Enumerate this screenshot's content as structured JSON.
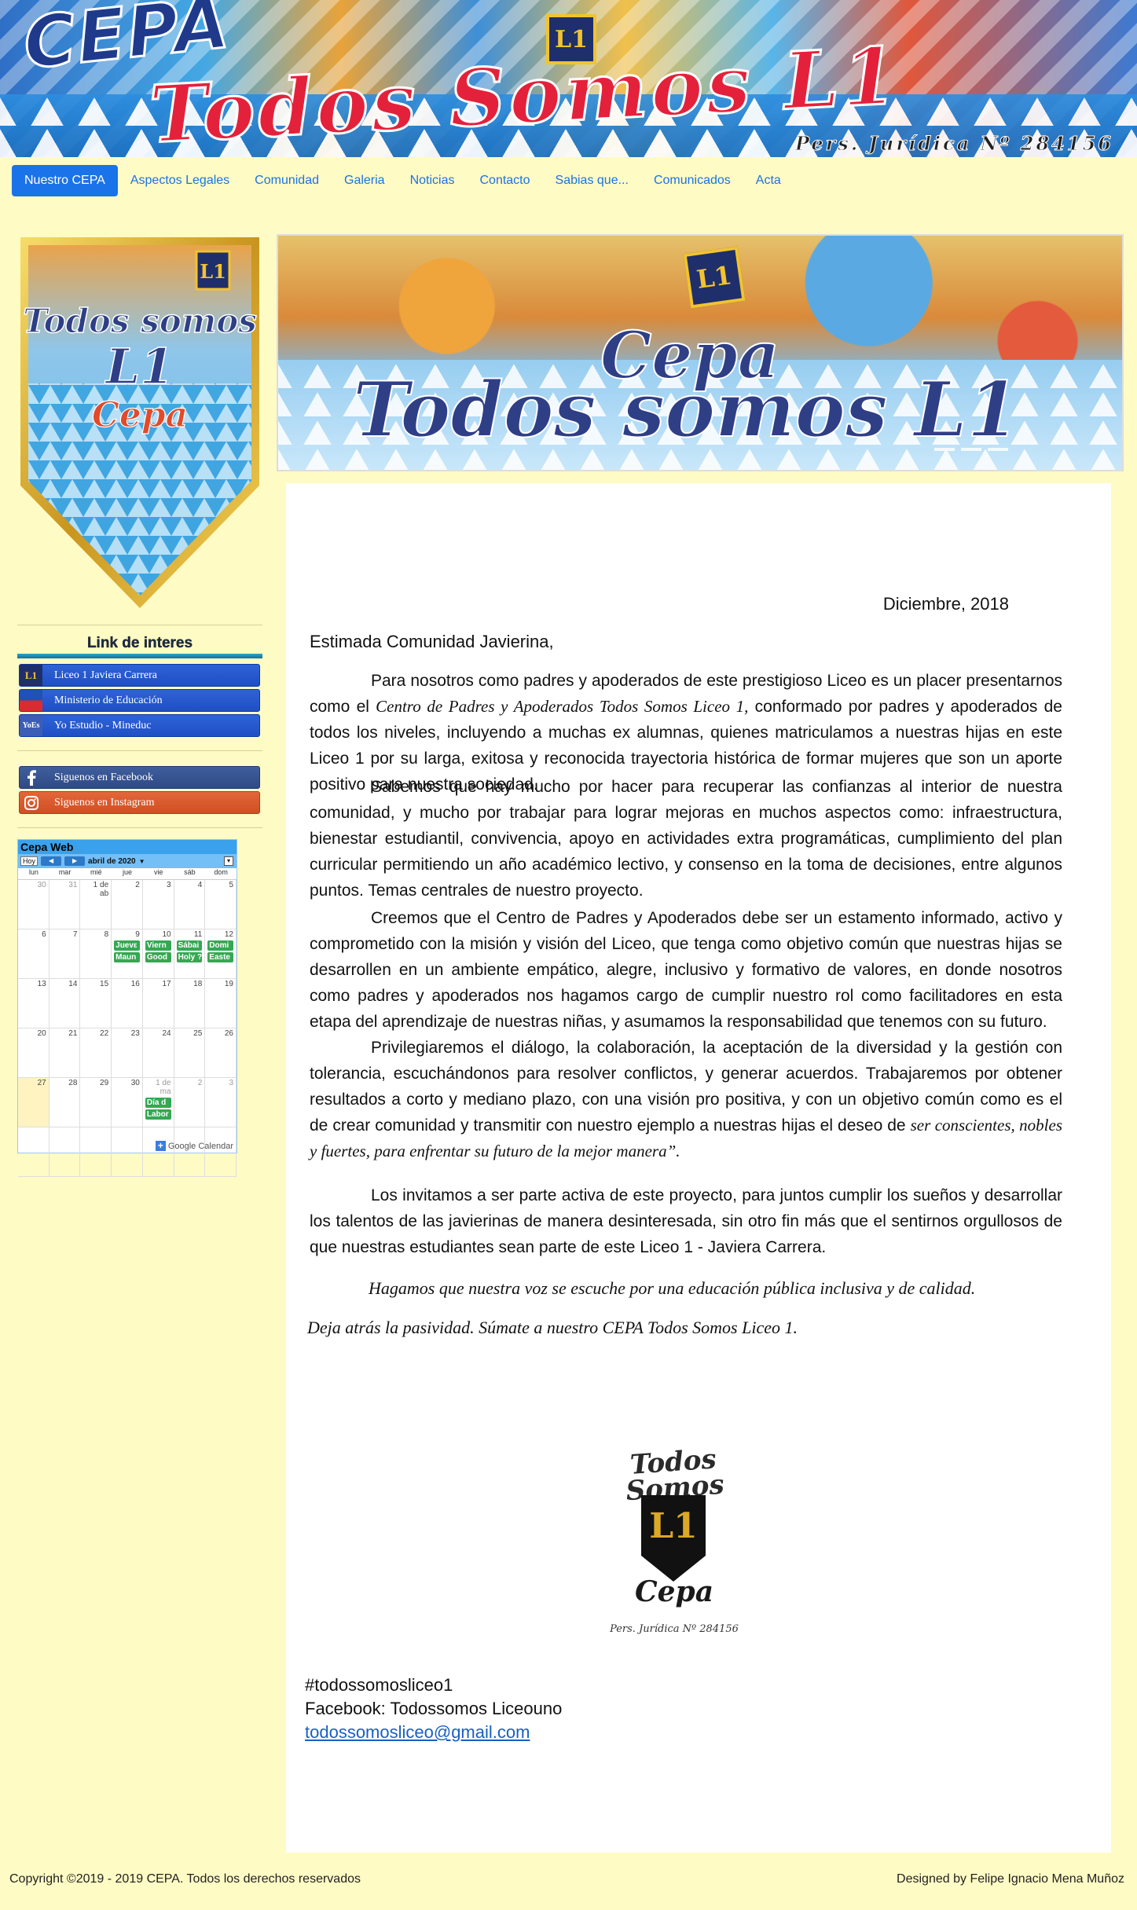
{
  "header": {
    "brand": "CEPA",
    "slogan": "Todos Somos L1",
    "badge": "L1",
    "legal": "Pers. Jurídica  Nº 284156"
  },
  "nav": {
    "items": [
      "Nuestro CEPA",
      "Aspectos Legales",
      "Comunidad",
      "Galeria",
      "Noticias",
      "Contacto",
      "Sabias que...",
      "Comunicados",
      "Acta"
    ],
    "active": "Nuestro CEPA"
  },
  "sidebar": {
    "pennant": {
      "line1": "Todos somos",
      "line2": "L1",
      "line3": "Cepa",
      "badge": "L1"
    },
    "links_title": "Link de interes",
    "links": [
      {
        "label": "Liceo 1 Javiera Carrera",
        "icon": "L1"
      },
      {
        "label": "Ministerio de Educación",
        "icon": ""
      },
      {
        "label": "Yo Estudio - Mineduc",
        "icon": "YoEs"
      }
    ],
    "social": [
      {
        "label": "Siguenos en Facebook",
        "icon": "facebook-icon"
      },
      {
        "label": "Siguenos en Instagram",
        "icon": "instagram-icon"
      }
    ]
  },
  "calendar": {
    "title": "Cepa Web",
    "today_button": "Hoy",
    "month": "abril de 2020",
    "weekdays": [
      "lun",
      "mar",
      "mié",
      "jue",
      "vie",
      "sáb",
      "dom"
    ],
    "weeks": [
      [
        {
          "d": "30",
          "o": true
        },
        {
          "d": "31",
          "o": true
        },
        {
          "d": "1 de ab"
        },
        {
          "d": "2"
        },
        {
          "d": "3"
        },
        {
          "d": "4"
        },
        {
          "d": "5"
        }
      ],
      [
        {
          "d": "6"
        },
        {
          "d": "7"
        },
        {
          "d": "8"
        },
        {
          "d": "9",
          "ev": [
            "Juevε",
            "Maun"
          ]
        },
        {
          "d": "10",
          "ev": [
            "Viern",
            "Good"
          ]
        },
        {
          "d": "11",
          "ev": [
            "Sábai",
            "Holy ?"
          ]
        },
        {
          "d": "12",
          "ev": [
            "Domi",
            "Easte"
          ]
        }
      ],
      [
        {
          "d": "13"
        },
        {
          "d": "14"
        },
        {
          "d": "15"
        },
        {
          "d": "16"
        },
        {
          "d": "17"
        },
        {
          "d": "18"
        },
        {
          "d": "19"
        }
      ],
      [
        {
          "d": "20"
        },
        {
          "d": "21"
        },
        {
          "d": "22"
        },
        {
          "d": "23"
        },
        {
          "d": "24"
        },
        {
          "d": "25"
        },
        {
          "d": "26"
        }
      ],
      [
        {
          "d": "27",
          "t": true
        },
        {
          "d": "28"
        },
        {
          "d": "29"
        },
        {
          "d": "30"
        },
        {
          "d": "1 de ma",
          "o": true,
          "ev": [
            "Día d",
            "Labor"
          ]
        },
        {
          "d": "2",
          "o": true
        },
        {
          "d": "3",
          "o": true
        }
      ],
      [
        {
          "d": ""
        },
        {
          "d": ""
        },
        {
          "d": ""
        },
        {
          "d": ""
        },
        {
          "d": ""
        },
        {
          "d": ""
        },
        {
          "d": ""
        }
      ]
    ],
    "footer": "Google Calendar",
    "footer_plus": "+"
  },
  "banner": {
    "line1": "Cepa",
    "line2": "Todos somos L1",
    "badge": "L1"
  },
  "letter": {
    "date": "Diciembre, 2018",
    "greeting": "Estimada Comunidad Javierina,",
    "p1_a": "Para nosotros como padres y apoderados de este prestigioso Liceo es un placer presentarnos como el ",
    "p1_em": "Centro de Padres y Apoderados Todos Somos Liceo 1,",
    "p1_b": " conformado por padres y apoderados de todos los niveles, incluyendo a muchas ex alumnas, quienes matriculamos a nuestras hijas en este Liceo 1 por su larga, exitosa y reconocida trayectoria histórica de formar mujeres que son un aporte positivo para nuestra sociedad.",
    "p2": "Sabemos que hay mucho por hacer para recuperar las confianzas al interior de nuestra comunidad, y mucho por trabajar para lograr mejoras en muchos aspectos como: infraestructura, bienestar estudiantil, convivencia, apoyo en actividades extra programáticas, cumplimiento del plan curricular permitiendo un año académico lectivo, y consenso en la toma de decisiones, entre algunos puntos. Temas centrales de nuestro proyecto.",
    "p3": "Creemos que el Centro de Padres y Apoderados debe ser un estamento informado, activo y comprometido con la misión y visión del Liceo, que tenga como objetivo común que nuestras hijas se desarrollen en un ambiente empático, alegre, inclusivo y formativo de valores, en donde nosotros como padres y apoderados nos hagamos cargo de cumplir nuestro rol como facilitadores en esta etapa del aprendizaje de nuestras niñas, y asumamos la responsabilidad que tenemos con su futuro.",
    "p4_a": "Privilegiaremos el diálogo, la colaboración, la aceptación de la diversidad y la gestión con tolerancia, escuchándonos para resolver conflictos, y generar acuerdos. Trabajaremos por obtener resultados a corto y mediano plazo, con una visión pro positiva, y con un objetivo común como es el de crear comunidad y transmitir con nuestro ejemplo a nuestras hijas el deseo de ",
    "p4_em": "ser conscientes, nobles y fuertes, para enfrentar su futuro de la mejor manera”.",
    "p5": "Los invitamos a ser parte activa de este proyecto, para juntos cumplir los sueños y desarrollar los talentos de las javierinas de manera desinteresada, sin otro fin más que el sentirnos orgullosos de que nuestras estudiantes sean parte de este Liceo 1 - Javiera Carrera.",
    "slogan1": "Hagamos que nuestra voz se escuche por una educación pública inclusiva y de calidad.",
    "slogan2": "Deja atrás la pasividad. Súmate a nuestro CEPA Todos Somos Liceo 1."
  },
  "logo": {
    "top": "Todos Somos",
    "badge": "L1",
    "name": "Cepa",
    "legal": "Pers. Jurídica Nº 284156"
  },
  "contact": {
    "hashtag": "#todossomosliceo1",
    "facebook": "Facebook: Todossomos Liceouno",
    "email": "todossomosliceo@gmail.com"
  },
  "footer": {
    "copyright": "Copyright ©2019 - 2019 CEPA. Todos los derechos reservados",
    "designer": "Designed by Felipe Ignacio Mena Muñoz"
  }
}
